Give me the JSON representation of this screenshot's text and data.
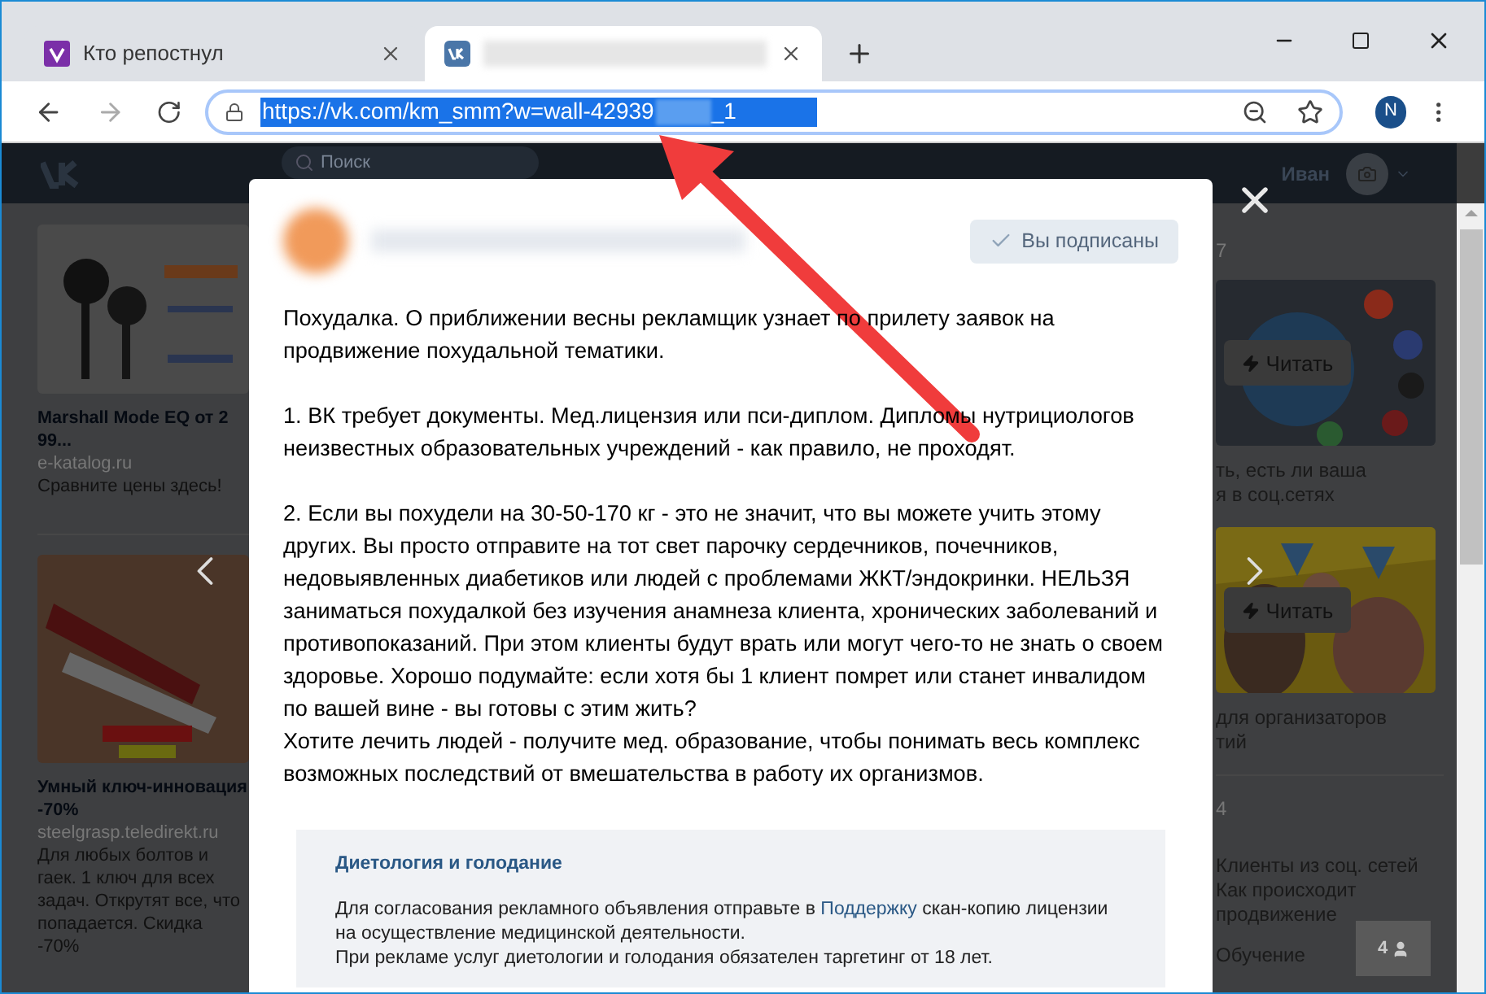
{
  "browser": {
    "tabs": [
      {
        "title": "Кто репостнул",
        "selected": false
      },
      {
        "selected": true
      }
    ],
    "address_bar": {
      "url_start": "https://vk.com/km_smm?w=wall-42939",
      "url_end": "_1"
    },
    "profile_letter": "N"
  },
  "vk_header": {
    "search_placeholder": "Поиск",
    "user_name": "Иван"
  },
  "left_ads": [
    {
      "title": "Marshall Mode EQ от 2 99...",
      "domain": "e-katalog.ru",
      "description": "Сравните цены здесь!"
    },
    {
      "title": "Умный ключ-инновация -70%",
      "domain": "steelgrasp.teledirekt.ru",
      "description": "Для любых болтов и гаек. 1 ключ для всех задач. Открутят все, что попадается. Скидка -70%"
    }
  ],
  "right_column": {
    "count_1": "7",
    "read_buttons": [
      "Читать",
      "Читать"
    ],
    "caption_1": [
      "ть, есть ли ваша",
      "я в соц.сетях"
    ],
    "caption_2": [
      "для организаторов",
      "тий"
    ],
    "count_2": "4",
    "links": [
      "Клиенты из соц. сетей",
      "Как происходит",
      "продвижение",
      "Обучение"
    ],
    "online_count": "4"
  },
  "modal": {
    "subscribe_button": "Вы подписаны",
    "paragraphs": [
      [
        "Похудалка. О приближении весны рекламщик узнает по прилету заявок на продвижение похудальной тематики."
      ],
      [
        "1. ВК требует документы. Мед.лицензия или пси-диплом. Дипломы нутрициологов неизвестных образовательных учреждений - как правило, не проходят."
      ],
      [
        "2. Если вы похудели на 30-50-170 кг - это не значит, что вы можете учить этому других. Вы просто отправите на тот свет парочку сердечников, почечников, недовыявленных диабетиков или людей с проблемами ЖКТ/эндокринки. НЕЛЬЗЯ заниматься похудалкой без изучения анамнеза клиента, хронических заболеваний и противопоказаний. При этом клиенты будут врать или могут чего-то не знать о своем здоровье. Хорошо подумайте: если хотя бы 1 клиент помрет или станет инвалидом по вашей вине - вы готовы с этим жить?",
        "Хотите лечить людей - получите мед. образование, чтобы понимать весь комплекс возможных последствий от вмешательства в работу их организмов."
      ]
    ],
    "notice": {
      "title": "Диетология и голодание",
      "text_before": "Для согласования рекламного объявления отправьте в",
      "link": "Поддержку",
      "text_after": "скан-копию лицензии на осуществление медицинской деятельности.",
      "text_2": "При рекламе услуг диетологии и голодания обязателен таргетинг от 18 лет."
    }
  }
}
